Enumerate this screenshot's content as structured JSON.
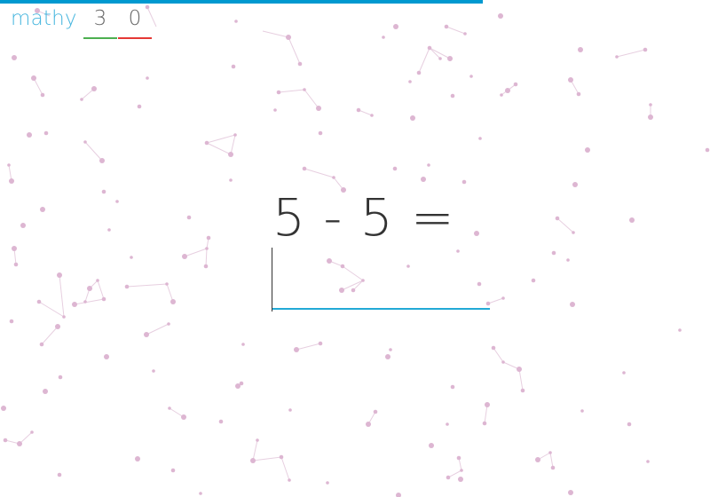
{
  "app": {
    "logo": "mathy"
  },
  "score": {
    "correct": "3",
    "wrong": "0",
    "correct_color": "#4caf50",
    "wrong_color": "#e53935"
  },
  "progress": {
    "fraction": 0.68,
    "color": "#0099d0"
  },
  "question": {
    "equation": "5 - 5 ="
  },
  "answer": {
    "value": "",
    "placeholder": ""
  },
  "background": {
    "dot_color": "#ddb6d2",
    "line_color": "#e7cfe0"
  }
}
